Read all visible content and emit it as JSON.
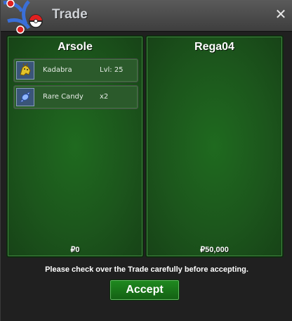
{
  "window": {
    "title": "Trade",
    "close_icon": "close-icon"
  },
  "left_trader": {
    "name": "Arsole",
    "money": "₽0",
    "items": [
      {
        "name": "Kadabra",
        "extra": "Lvl: 25",
        "icon": "kadabra-sprite-icon"
      },
      {
        "name": "Rare Candy",
        "extra": "x2",
        "icon": "rare-candy-icon"
      }
    ]
  },
  "right_trader": {
    "name": "Rega04",
    "money": "₽50,000",
    "items": []
  },
  "footer": {
    "notice": "Please check over the Trade carefully before accepting.",
    "accept_label": "Accept"
  },
  "colors": {
    "panel_green": "#1f6a1f",
    "button_green": "#1f8a1f",
    "title_bar": "#4a4a4a"
  }
}
